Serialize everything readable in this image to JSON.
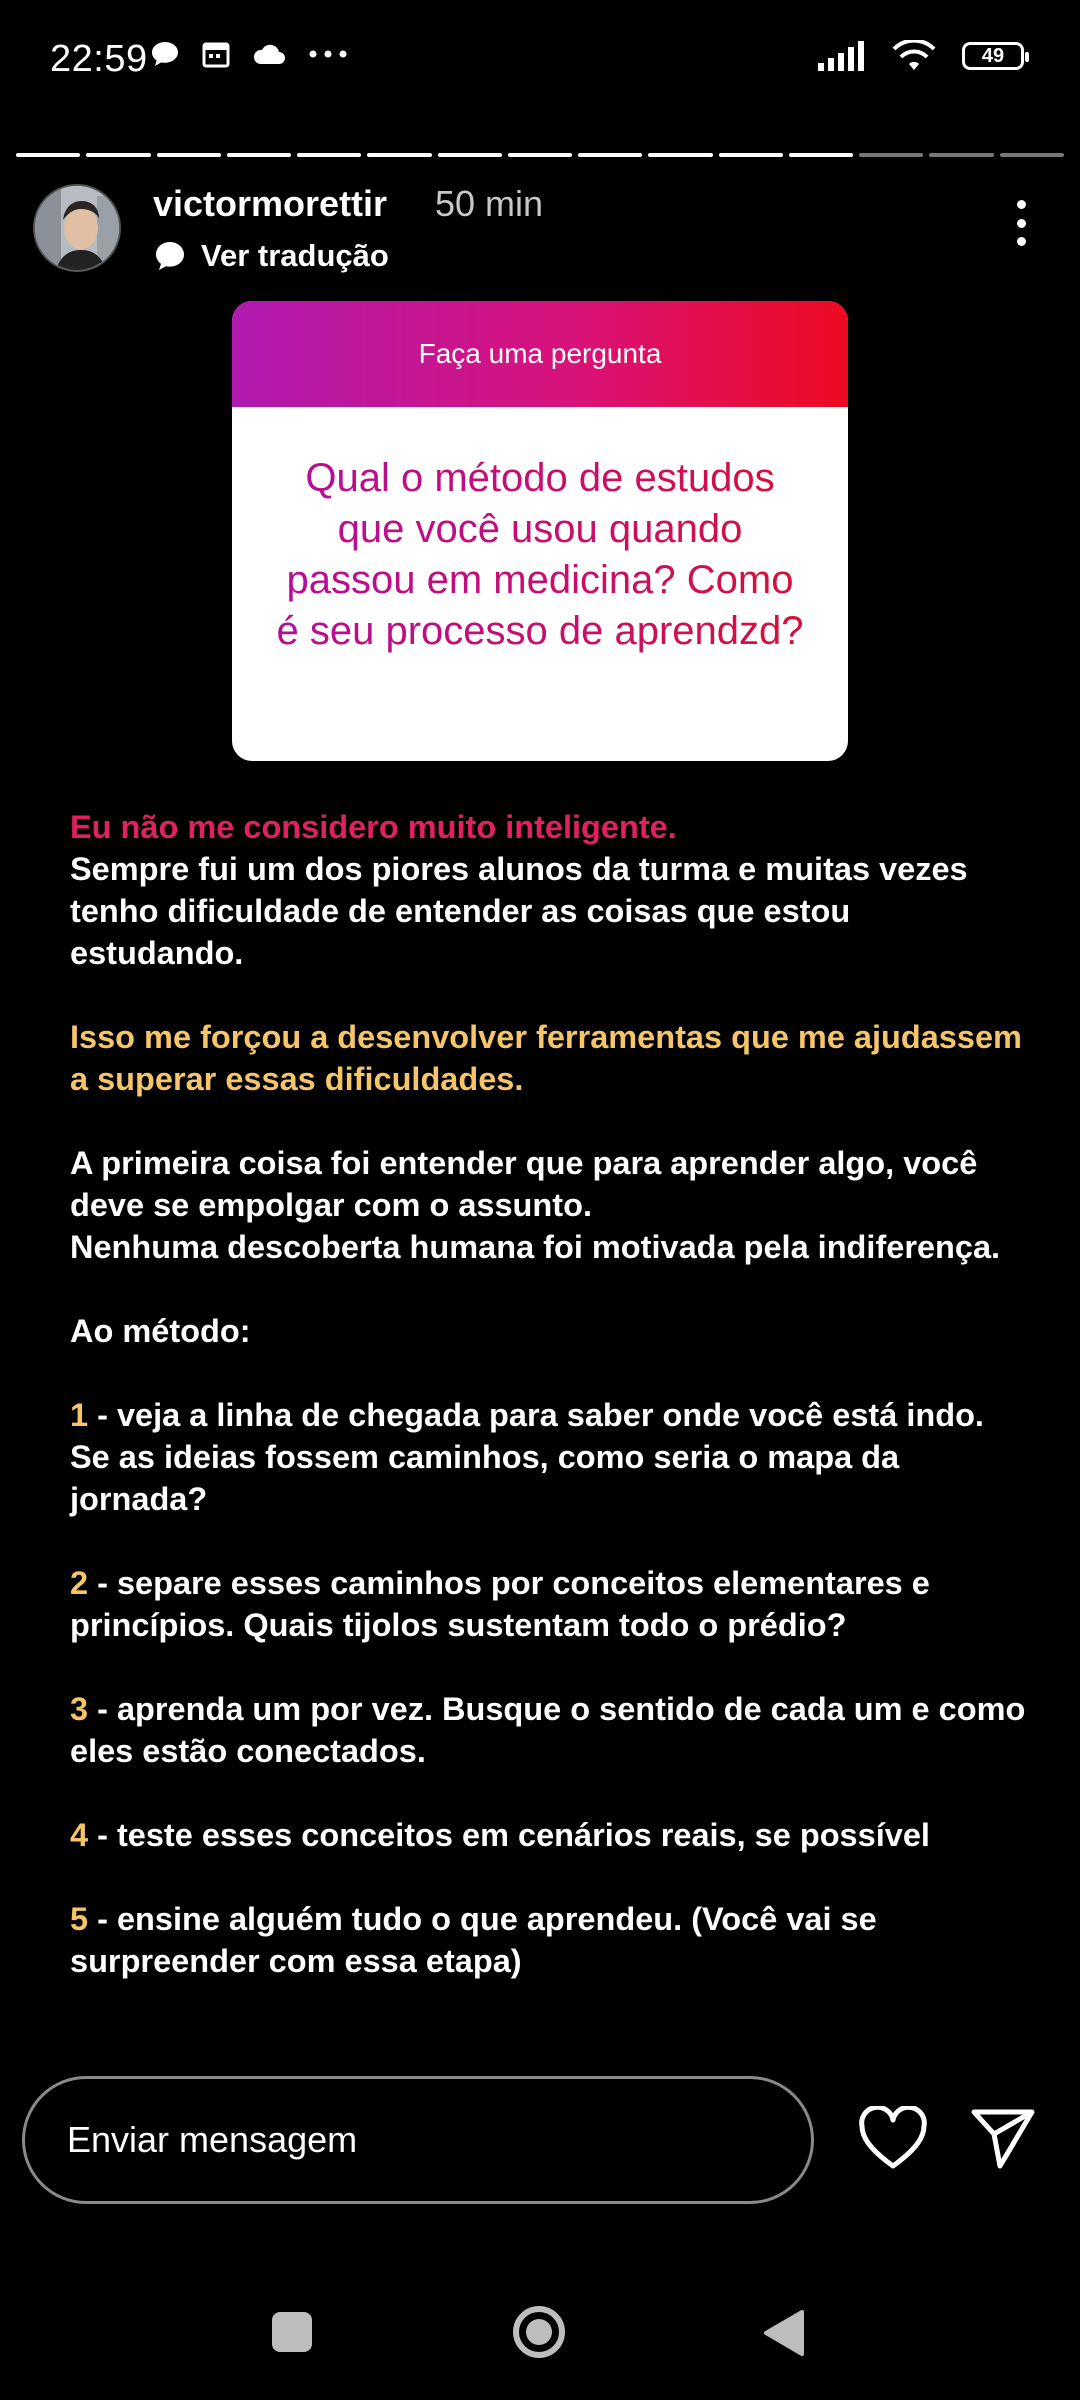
{
  "status_bar": {
    "time": "22:59",
    "battery": "49",
    "icons_left": [
      "chat-bubble-icon",
      "calendar-icon",
      "cloud-icon",
      "more-dots-icon"
    ],
    "icons_right": [
      "signal-icon",
      "wifi-icon",
      "battery-icon"
    ]
  },
  "story": {
    "segments_total": 15,
    "segments_viewed": 12,
    "username": "victormorettir",
    "time_ago": "50 min",
    "translate_label": "Ver tradução"
  },
  "question_card": {
    "header": "Faça uma pergunta",
    "question": "Qual o método de estudos que você usou quando passou em medicina? Como é seu processo de aprendzd?"
  },
  "body": {
    "p1_highlight": "Eu não me considero muito inteligente.",
    "p1_rest": "Sempre fui um dos piores alunos da turma e muitas vezes tenho dificuldade de entender as coisas que estou estudando.",
    "p2": "Isso me forçou a desenvolver ferramentas que me ajudassem a superar essas dificuldades.",
    "p3_line1": "A primeira coisa foi entender que para aprender algo, você deve se empolgar com o assunto.",
    "p3_line2": "Nenhuma descoberta humana foi motivada pela indiferença.",
    "p4": "Ao método:",
    "steps": [
      {
        "num": "1",
        "text": " - veja a linha de chegada para saber onde você está indo. Se as ideias fossem caminhos, como seria o mapa da jornada?"
      },
      {
        "num": "2",
        "text": " - separe esses caminhos por conceitos elementares e princípios. Quais tijolos sustentam todo o prédio?"
      },
      {
        "num": "3",
        "text": " - aprenda um por vez. Busque o sentido de cada um e como eles estão conectados."
      },
      {
        "num": "4",
        "text": " - teste esses conceitos em cenários reais, se possível"
      },
      {
        "num": "5",
        "text": " - ensine alguém tudo o que aprendeu. (Você vai se surpreender com essa etapa)"
      }
    ]
  },
  "composer": {
    "placeholder": "Enviar mensagem"
  },
  "colors": {
    "pink": "#e0215f",
    "yellow": "#f6c56a",
    "gradient_start": "#b01ab0",
    "gradient_end": "#ee0a20"
  }
}
